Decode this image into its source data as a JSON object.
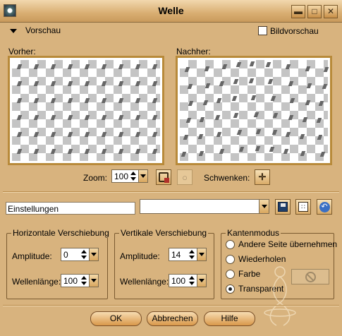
{
  "window": {
    "title": "Welle",
    "buttons": {
      "minimize": "▬",
      "maximize": "□",
      "close": "✕"
    }
  },
  "preview_section": {
    "header_label": "Vorschau",
    "bildvorschau_label": "Bildvorschau",
    "bildvorschau_checked": false,
    "before_label": "Vorher:",
    "after_label": "Nachher:"
  },
  "zoom": {
    "label": "Zoom:",
    "value": "100"
  },
  "pan": {
    "label": "Schwenken:"
  },
  "presets": {
    "label": "Einstellungen",
    "value": ""
  },
  "horizontal": {
    "legend": "Horizontale Verschiebung",
    "amplitude_label": "Amplitude:",
    "amplitude_value": "0",
    "wavelength_label": "Wellenlänge:",
    "wavelength_value": "100"
  },
  "vertical": {
    "legend": "Vertikale Verschiebung",
    "amplitude_label": "Amplitude:",
    "amplitude_value": "14",
    "wavelength_label": "Wellenlänge:",
    "wavelength_value": "100"
  },
  "edge_mode": {
    "legend": "Kantenmodus",
    "options": [
      {
        "label": "Andere Seite übernehmen",
        "selected": false
      },
      {
        "label": "Wiederholen",
        "selected": false
      },
      {
        "label": "Farbe",
        "selected": false
      },
      {
        "label": "Transparent",
        "selected": true
      }
    ]
  },
  "actions": {
    "ok": "OK",
    "cancel": "Abbrechen",
    "help": "Hilfe"
  },
  "colors": {
    "background": "#d8b37e",
    "accent": "#b88a3a"
  }
}
